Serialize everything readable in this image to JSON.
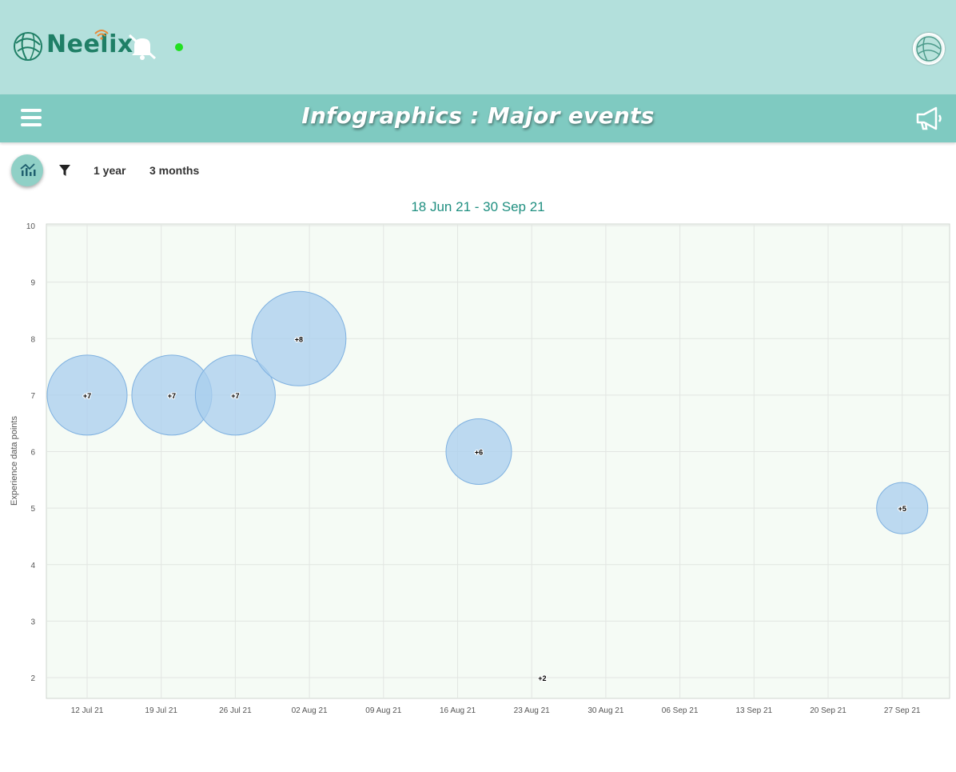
{
  "app": {
    "logo_text": "Neelix",
    "status_color": "#22e022",
    "icons": [
      "bell-off-icon",
      "avatar-globe-icon",
      "hamburger-menu-icon",
      "megaphone-icon",
      "chart-icon",
      "filter-icon",
      "context-menu-icon"
    ]
  },
  "header": {
    "title": "Infographics : Major events"
  },
  "toolbar": {
    "range_1y": "1 year",
    "range_3m": "3 months"
  },
  "chart_data": {
    "type": "bubble",
    "title": "18 Jun 21 - 30 Sep 21",
    "xlabel": "",
    "ylabel": "Experience data points",
    "ylim": [
      1.5,
      10
    ],
    "x_ticks": [
      "12 Jul 21",
      "19 Jul 21",
      "26 Jul 21",
      "02 Aug 21",
      "09 Aug 21",
      "16 Aug 21",
      "23 Aug 21",
      "30 Aug 21",
      "06 Sep 21",
      "13 Sep 21",
      "20 Sep 21",
      "27 Sep 21"
    ],
    "y_ticks": [
      2,
      3,
      4,
      5,
      6,
      7,
      8,
      9,
      10
    ],
    "grid": true,
    "colors": {
      "bubble_fill": "#a8cdee",
      "bubble_stroke": "#7fb1e0",
      "plot_bg": "#f5fbf5",
      "grid": "#e2e6e2"
    },
    "points": [
      {
        "date": "2021-07-12",
        "y": 7,
        "label": "+7"
      },
      {
        "date": "2021-07-20",
        "y": 7,
        "label": "+7"
      },
      {
        "date": "2021-07-26",
        "y": 7,
        "label": "+7"
      },
      {
        "date": "2021-08-01",
        "y": 8,
        "label": "+8"
      },
      {
        "date": "2021-08-18",
        "y": 6,
        "label": "+6"
      },
      {
        "date": "2021-08-24",
        "y": 2,
        "label": "+2"
      },
      {
        "date": "2021-09-27",
        "y": 5,
        "label": "+5"
      }
    ]
  }
}
